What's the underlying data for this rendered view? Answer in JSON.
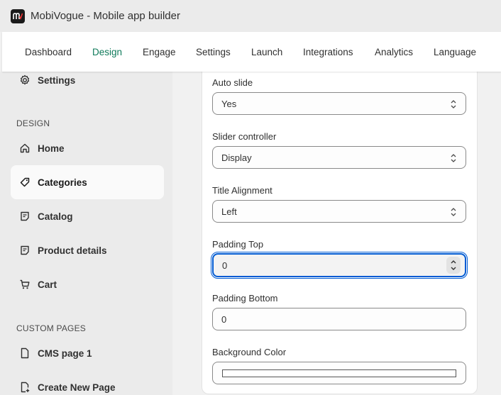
{
  "app": {
    "title": "MobiVogue - Mobile app builder"
  },
  "nav": {
    "tabs": [
      {
        "label": "Dashboard"
      },
      {
        "label": "Design",
        "active": true
      },
      {
        "label": "Engage"
      },
      {
        "label": "Settings"
      },
      {
        "label": "Launch"
      },
      {
        "label": "Integrations"
      },
      {
        "label": "Analytics"
      },
      {
        "label": "Language"
      }
    ]
  },
  "sidebar": {
    "settings_label": "Settings",
    "section_design": "DESIGN",
    "items": [
      {
        "label": "Home",
        "icon": "home-icon"
      },
      {
        "label": "Categories",
        "icon": "tag-icon",
        "selected": true
      },
      {
        "label": "Catalog",
        "icon": "note-icon"
      },
      {
        "label": "Product details",
        "icon": "note-icon"
      },
      {
        "label": "Cart",
        "icon": "cart-icon"
      }
    ],
    "section_custom": "CUSTOM PAGES",
    "custom_items": [
      {
        "label": "CMS page 1",
        "icon": "file-icon"
      },
      {
        "label": "Create New Page",
        "icon": "file-plus-icon"
      }
    ]
  },
  "form": {
    "auto_slide": {
      "label": "Auto slide",
      "value": "Yes"
    },
    "slider_controller": {
      "label": "Slider controller",
      "value": "Display"
    },
    "title_alignment": {
      "label": "Title Alignment",
      "value": "Left"
    },
    "padding_top": {
      "label": "Padding Top",
      "value": "0"
    },
    "padding_bottom": {
      "label": "Padding Bottom",
      "value": "0"
    },
    "background_color": {
      "label": "Background Color",
      "value": "#ffffff"
    }
  },
  "colors": {
    "accent": "#0f7a5a",
    "focus": "#005bd3",
    "sidebar_bg": "#ebebeb"
  }
}
